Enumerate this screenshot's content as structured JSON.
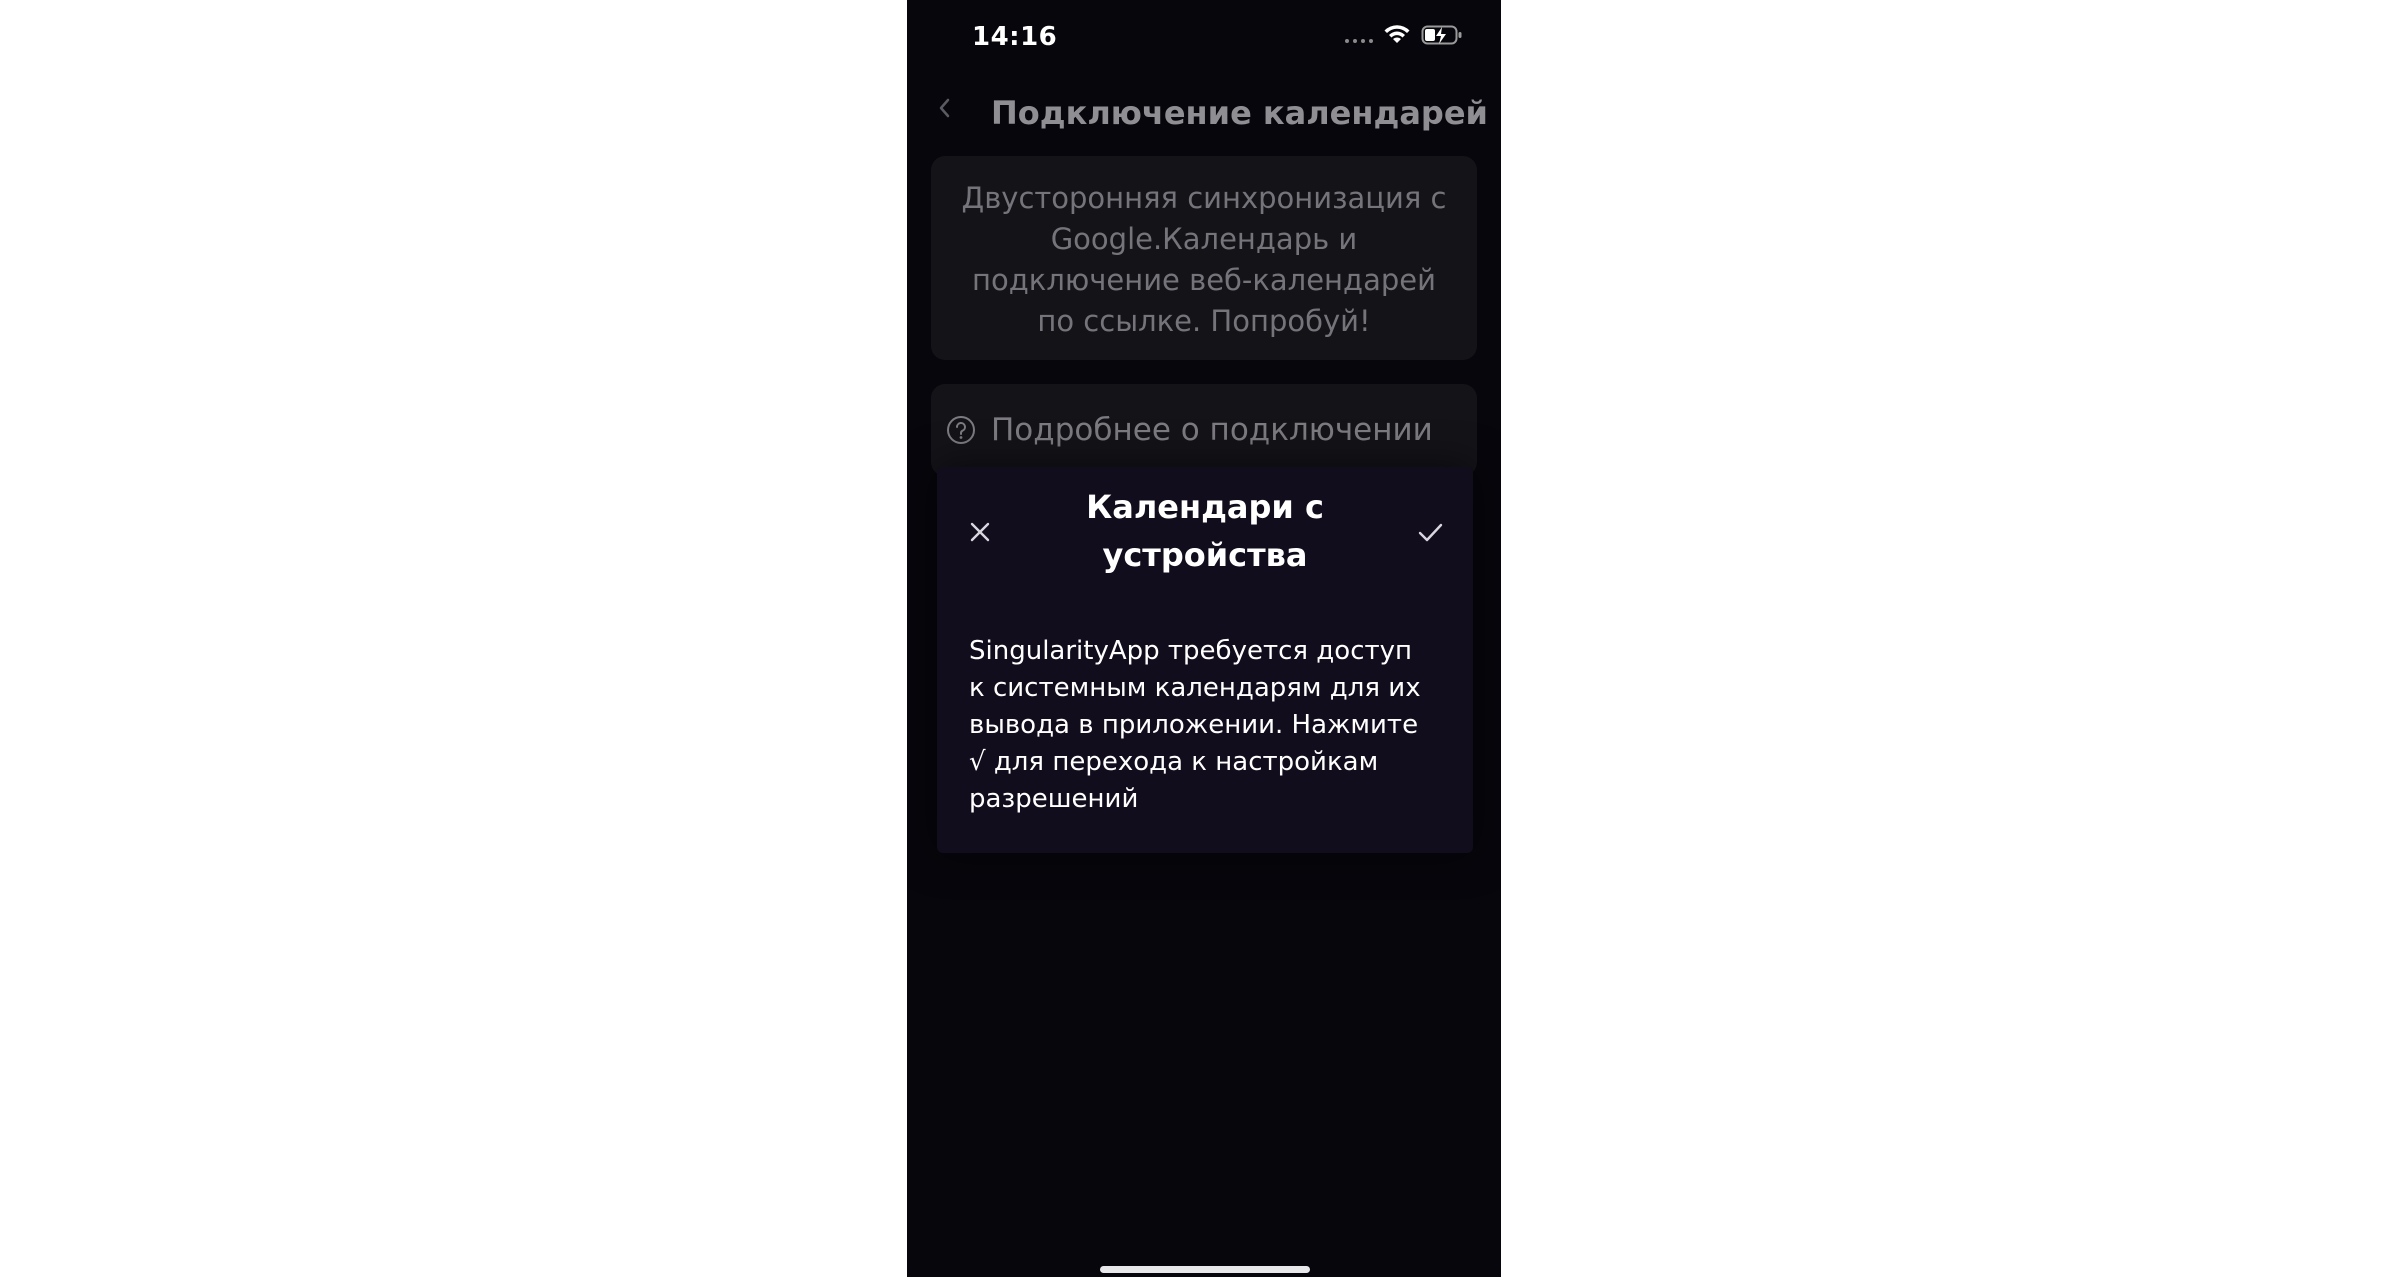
{
  "status_bar": {
    "time": "14:16",
    "icons": [
      "signal-dots-icon",
      "wifi-icon",
      "battery-charging-icon"
    ]
  },
  "background_screen": {
    "back_icon": "chevron-left-icon",
    "title": "Подключение календарей",
    "info_text": "Двусторонняя синхронизация с Google.Календарь и подключение веб-календарей по ссылке. Попробуй!",
    "more_link": {
      "icon": "question-circle-icon",
      "label": "Подробнее о подключении"
    }
  },
  "modal": {
    "close_icon": "close-icon",
    "title": "Календари с устройства",
    "confirm_icon": "checkmark-icon",
    "body": "SingularityApp требуется доступ к системным календарям для их вывода в приложении. Нажмите √ для перехода к настройкам разрешений"
  },
  "colors": {
    "phone_background": "#07060c",
    "card_background": "#141318",
    "modal_background": "#120d1d",
    "text_primary": "#ffffff",
    "text_dimmed": "#75747a"
  }
}
